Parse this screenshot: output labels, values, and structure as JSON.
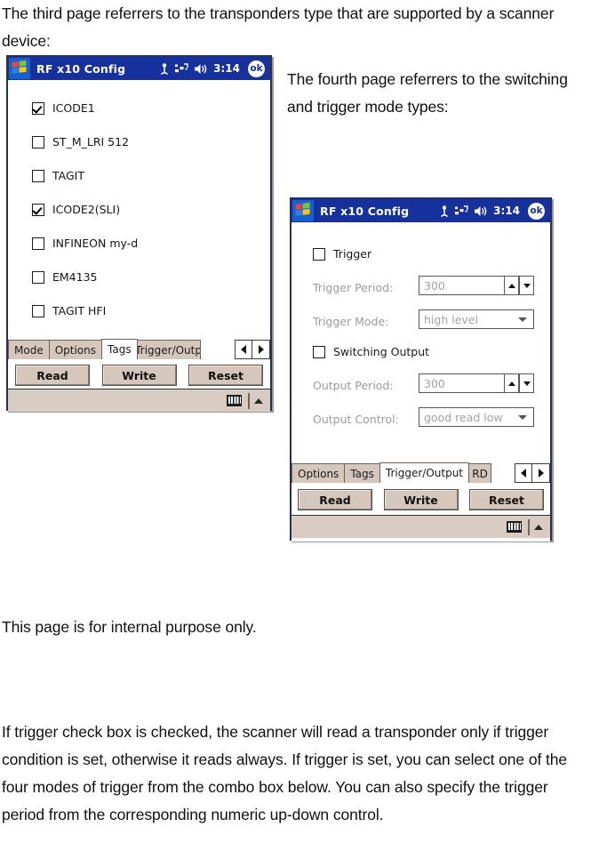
{
  "document": {
    "intro_paragraph": "The third page referrers to the transponders type that are supported by a scanner device:",
    "fourth_paragraph": "The fourth page referrers to the switching and trigger mode types:",
    "internal_paragraph": "This page is for internal purpose only.",
    "trigger_paragraph": "If trigger check box is checked, the scanner will read a transponder only if trigger condition is set, otherwise it reads always. If trigger is set, you can select one of the four modes of trigger from the combo box below. You can also specify the trigger period from the corresponding numeric up-down control."
  },
  "colors": {
    "titlebar_blue": "#17319c",
    "window_border": "#2a2f52",
    "tab_face": "#d6c7bd",
    "button_face": "#d6c7bd",
    "sip_face": "#d8cbc2",
    "disabled_text": "#9b9b9b"
  },
  "tags_window": {
    "titlebar": {
      "start_icon": "windows-flag-icon",
      "title": "RF x10 Config",
      "icons": [
        "signal-icon",
        "connectivity-icon",
        "speaker-icon"
      ],
      "time": "3:14",
      "ok_label": "ok"
    },
    "checkboxes": [
      {
        "label": "ICODE1",
        "checked": true
      },
      {
        "label": "ST_M_LRI 512",
        "checked": false
      },
      {
        "label": "TAGIT",
        "checked": false
      },
      {
        "label": "ICODE2(SLI)",
        "checked": true
      },
      {
        "label": "INFINEON my-d",
        "checked": false
      },
      {
        "label": "EM4135",
        "checked": false
      },
      {
        "label": "TAGIT HFI",
        "checked": false
      }
    ],
    "tabs": [
      {
        "label": "Mode",
        "active": false
      },
      {
        "label": "Options",
        "active": false
      },
      {
        "label": "Tags",
        "active": true
      },
      {
        "label": "Trigger/Outp",
        "active": false
      }
    ],
    "tab_nav": {
      "prev": "left-arrow-icon",
      "next": "right-arrow-icon"
    },
    "buttons": [
      "Read",
      "Write",
      "Reset"
    ],
    "sip": {
      "keyboard": "keyboard-icon",
      "expander": "up-arrow-icon"
    }
  },
  "trigger_window": {
    "titlebar": {
      "start_icon": "windows-flag-icon",
      "title": "RF x10 Config",
      "icons": [
        "signal-icon",
        "connectivity-icon",
        "speaker-icon"
      ],
      "time": "3:14",
      "ok_label": "ok"
    },
    "trigger_checkbox": {
      "label": "Trigger",
      "checked": false
    },
    "trigger_period": {
      "label": "Trigger Period:",
      "value": "300"
    },
    "trigger_mode": {
      "label": "Trigger Mode:",
      "value": "high level"
    },
    "switching_checkbox": {
      "label": "Switching Output",
      "checked": false
    },
    "output_period": {
      "label": "Output Period:",
      "value": "300"
    },
    "output_control": {
      "label": "Output Control:",
      "value": "good read low"
    },
    "tabs": [
      {
        "label": "Options",
        "active": false
      },
      {
        "label": "Tags",
        "active": false
      },
      {
        "label": "Trigger/Output",
        "active": true
      },
      {
        "label": "RD",
        "active": false
      }
    ],
    "tab_nav": {
      "prev": "left-arrow-icon",
      "next": "right-arrow-icon"
    },
    "buttons": [
      "Read",
      "Write",
      "Reset"
    ],
    "sip": {
      "keyboard": "keyboard-icon",
      "expander": "up-arrow-icon"
    }
  }
}
